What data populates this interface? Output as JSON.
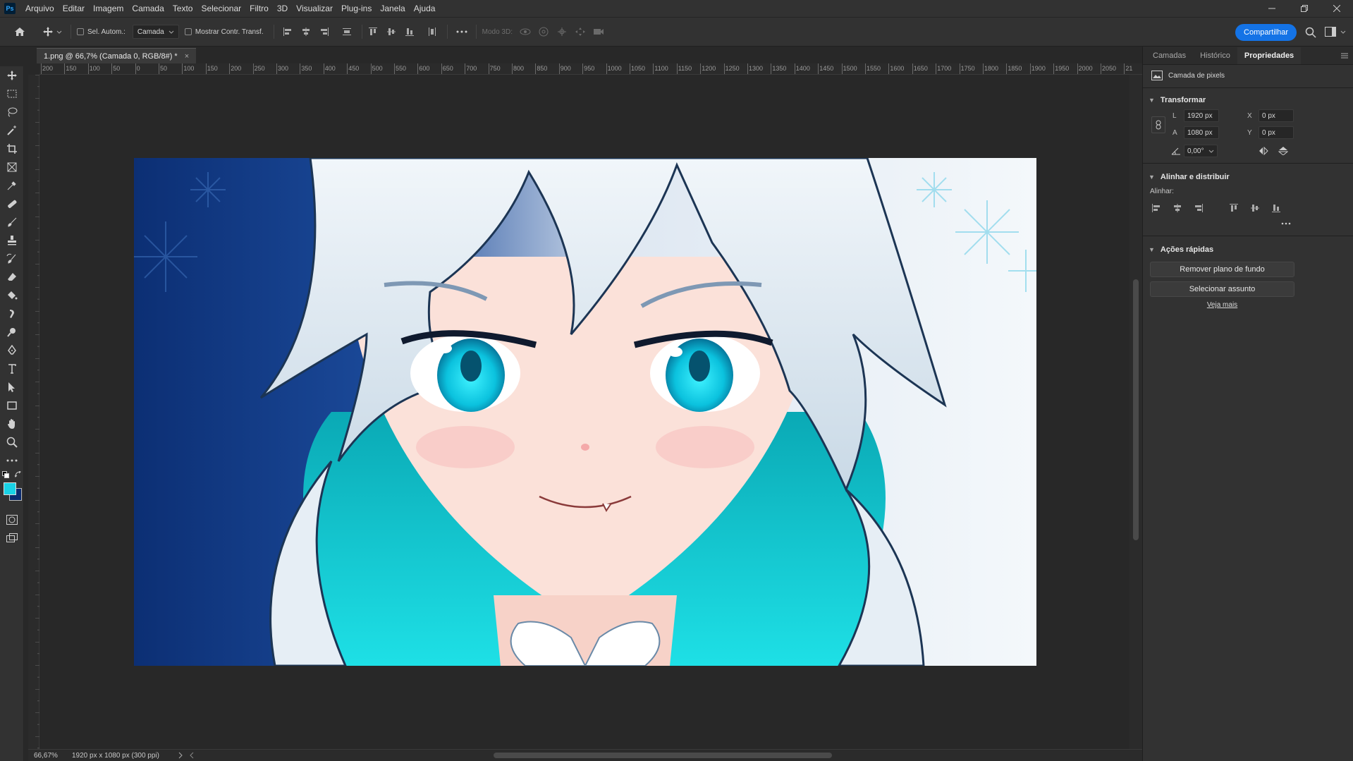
{
  "menubar": {
    "logo": "Ps",
    "items": [
      "Arquivo",
      "Editar",
      "Imagem",
      "Camada",
      "Texto",
      "Selecionar",
      "Filtro",
      "3D",
      "Visualizar",
      "Plug-ins",
      "Janela",
      "Ajuda"
    ]
  },
  "options": {
    "auto_select_label": "Sel. Autom.:",
    "auto_select_value": "Camada",
    "show_transform_label": "Mostrar Contr. Transf.",
    "mode_3d_label": "Modo 3D:",
    "share_label": "Compartilhar"
  },
  "document": {
    "tab_title": "1.png @ 66,7% (Camada 0, RGB/8#) *",
    "close_glyph": "×"
  },
  "ruler": {
    "labels": [
      "200",
      "150",
      "100",
      "50",
      "0",
      "50",
      "100",
      "150",
      "200",
      "250",
      "300",
      "350",
      "400",
      "450",
      "500",
      "550",
      "600",
      "650",
      "700",
      "750",
      "800",
      "850",
      "900",
      "950",
      "1000",
      "1050",
      "1100",
      "1150",
      "1200",
      "1250",
      "1300",
      "1350",
      "1400",
      "1450",
      "1500",
      "1550",
      "1600",
      "1650",
      "1700",
      "1750",
      "1800",
      "1850",
      "1900",
      "1950",
      "2000",
      "2050",
      "21"
    ]
  },
  "status": {
    "zoom": "66,67%",
    "doc_info": "1920 px x 1080 px (300 ppi)"
  },
  "panel": {
    "tabs": [
      "Camadas",
      "Histórico",
      "Propriedades"
    ],
    "active_tab": "Propriedades",
    "layer_kind": "Camada de pixels",
    "transform": {
      "title": "Transformar",
      "w_label": "L",
      "w_value": "1920 px",
      "h_label": "A",
      "h_value": "1080 px",
      "x_label": "X",
      "x_value": "0 px",
      "y_label": "Y",
      "y_value": "0 px",
      "angle_value": "0,00°"
    },
    "align": {
      "title": "Alinhar e distribuir",
      "label": "Alinhar:"
    },
    "quick_actions": {
      "title": "Ações rápidas",
      "remove_bg": "Remover plano de fundo",
      "select_subject": "Selecionar assunto",
      "see_more": "Veja mais"
    }
  },
  "colors": {
    "foreground": "#19d2e6",
    "background": "#0a2a6e",
    "accent": "#1473e6"
  }
}
